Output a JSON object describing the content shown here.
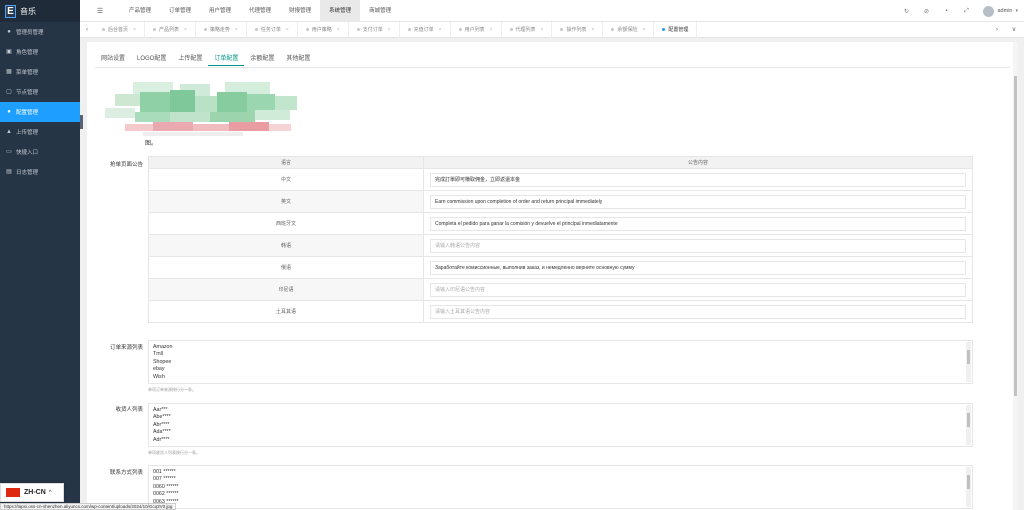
{
  "app": {
    "logo_letter": "E",
    "logo_text": "音乐"
  },
  "sidebar": {
    "items": [
      {
        "label": "管理员管理",
        "icon": "user-icon",
        "glyph": "●"
      },
      {
        "label": "角色管理",
        "icon": "role-icon",
        "glyph": "▣"
      },
      {
        "label": "菜单管理",
        "icon": "menu-icon",
        "glyph": "▦"
      },
      {
        "label": "节点管理",
        "icon": "node-icon",
        "glyph": "▢"
      },
      {
        "label": "配置管理",
        "icon": "config-icon",
        "glyph": "●"
      },
      {
        "label": "上传管理",
        "icon": "upload-icon",
        "glyph": "▲"
      },
      {
        "label": "快捷入口",
        "icon": "shortcut-icon",
        "glyph": "▭"
      },
      {
        "label": "日志管理",
        "icon": "log-icon",
        "glyph": "▤"
      }
    ],
    "active_index": 4
  },
  "topbar": {
    "menu_glyph": "☰",
    "items": [
      "产品管理",
      "订单管理",
      "用户管理",
      "代理管理",
      "财报管理",
      "系统管理",
      "商城管理"
    ],
    "active_index": 5,
    "right_icons": [
      {
        "name": "refresh-icon",
        "glyph": "↻"
      },
      {
        "name": "clear-icon",
        "glyph": "⊘"
      },
      {
        "name": "lock-icon",
        "glyph": "▪"
      },
      {
        "name": "fullscreen-icon",
        "glyph": "⤢"
      }
    ],
    "user": "admin",
    "caret": "▾"
  },
  "tabs": {
    "prev_glyph": "‹",
    "next_glyph": "›",
    "more_glyph": "∨",
    "close_glyph": "×",
    "items": [
      "后台首页",
      "产品列表",
      "策略走势",
      "任务订单",
      "用户策略",
      "支付订单",
      "充值订单",
      "用户列表",
      "代理列表",
      "操作列表",
      "余额保险",
      "配置管理"
    ],
    "active_index": 11
  },
  "subtabs": {
    "items": [
      "网站设置",
      "LOGO配置",
      "上传配置",
      "订单配置",
      "余额配置",
      "其他配置"
    ],
    "active_index": 3
  },
  "blurred_tail": "图。",
  "notice": {
    "label": "抢单页面公告",
    "col_lang": "语言",
    "col_content": "公告内容",
    "rows": [
      {
        "lang": "中文",
        "value": "完成訂單即可賺取佣金，立即返還本金",
        "placeholder": false
      },
      {
        "lang": "英文",
        "value": "Earn commission upon completion of order and return principal immediately",
        "placeholder": false
      },
      {
        "lang": "西班牙文",
        "value": "Completa el pedido para ganar la comisión y devuelve el principal inmediatamente",
        "placeholder": false
      },
      {
        "lang": "韩语",
        "value": "请输入韩语公告内容",
        "placeholder": true
      },
      {
        "lang": "俄语",
        "value": "Заработайте комиссионные, выполнив заказ, и немедленно верните основную сумму",
        "placeholder": false
      },
      {
        "lang": "印尼语",
        "value": "请输入印尼语公告内容",
        "placeholder": true
      },
      {
        "lang": "土耳其语",
        "value": "请输入土耳其语公告内容",
        "placeholder": true
      }
    ]
  },
  "order_source": {
    "label": "订单来源列表",
    "items": [
      "Amazon",
      "Tmll",
      "Shopee",
      "ebay",
      "Wish"
    ],
    "hint": "单项订单来源按行分一条。"
  },
  "receiver": {
    "label": "收货人列表",
    "items": [
      "Aar***",
      "Abe****",
      "Abr****",
      "Ada****",
      "Adr****"
    ],
    "hint": "单项收货人列表按行分一条。"
  },
  "contact": {
    "label": "联系方式列表",
    "items": [
      "001 ******",
      "007 ******",
      "0060 ******",
      "0062 ******",
      "0063 ******"
    ]
  },
  "language": {
    "code": "ZH-CN",
    "caret": "^",
    "flag_color": "#de2910"
  },
  "status_url": "https://tapsi.oss-cn-shenzhen.aliyuncs.com/wp-content/uploads/2024/10/Gcq3V0.jpg",
  "colors": {
    "sidebar_bg": "#263545",
    "active_blue": "#1e9fff",
    "tab_active": "#009688"
  }
}
